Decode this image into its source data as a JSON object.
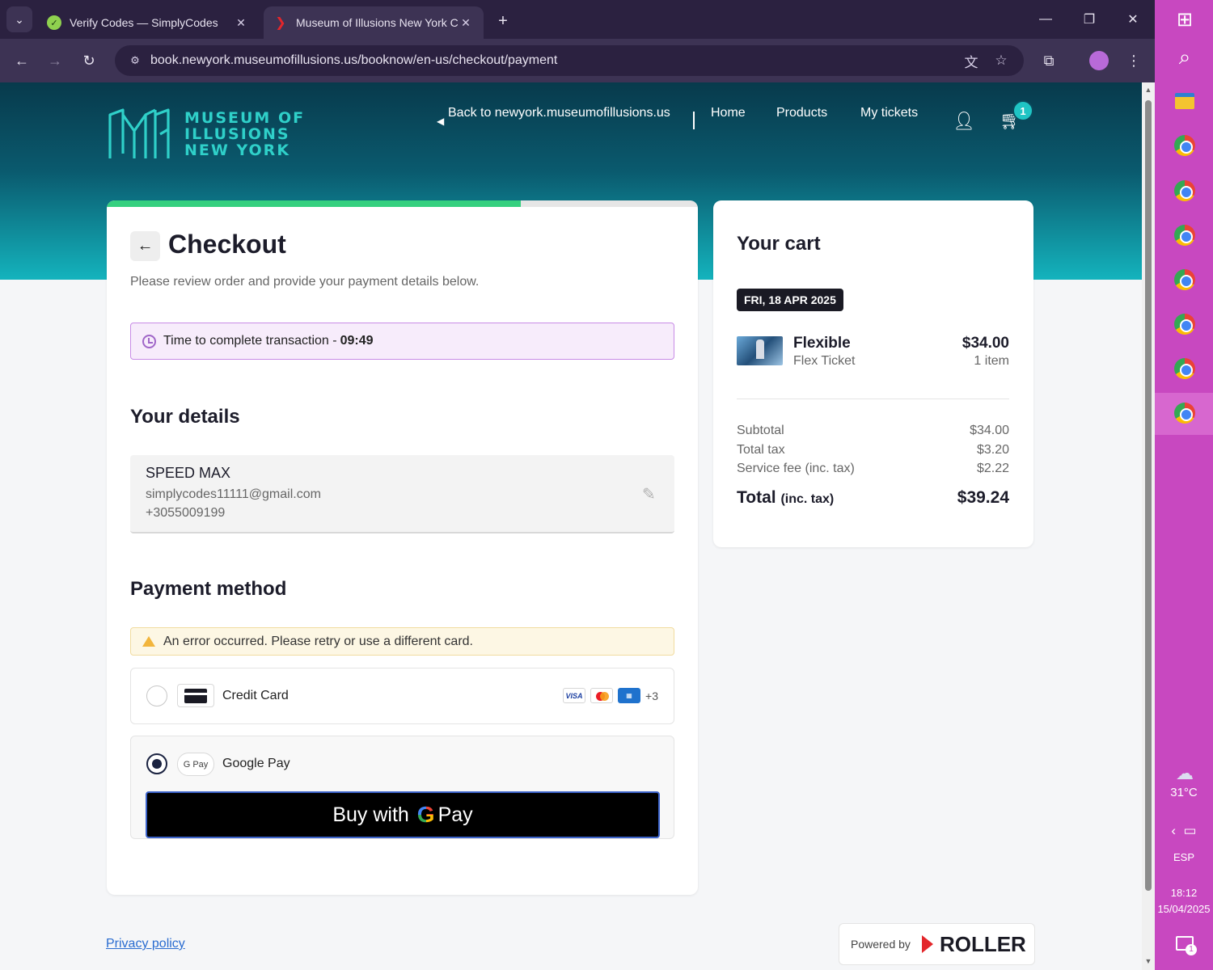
{
  "browser": {
    "tabs": [
      {
        "title": "Verify Codes — SimplyCodes",
        "active": false
      },
      {
        "title": "Museum of Illusions New York Checkout",
        "active": true
      }
    ],
    "url": "book.newyork.museumofillusions.us/booknow/en-us/checkout/payment"
  },
  "header": {
    "logo_lines": [
      "MUSEUM OF",
      "ILLUSIONS",
      "NEW YORK"
    ],
    "nav": {
      "back_link": "Back to newyork.museumofillusions.us",
      "home": "Home",
      "products": "Products",
      "my_tickets": "My tickets"
    },
    "cart_count": "1"
  },
  "checkout": {
    "progress_fraction": 0.7,
    "title": "Checkout",
    "subtitle": "Please review order and provide your payment details below.",
    "timer_label": "Time to complete transaction - ",
    "timer_value": "09:49",
    "details_heading": "Your details",
    "details": {
      "name": "SPEED MAX",
      "email": "simplycodes11111@gmail.com",
      "phone": "+3055009199"
    },
    "payment_heading": "Payment method",
    "error": "An error occurred. Please retry or use a different card.",
    "methods": {
      "credit_card": "Credit Card",
      "google_pay": "Google Pay",
      "gpay_icon": "G Pay",
      "brands": {
        "visa": "VISA",
        "more": "+3"
      }
    },
    "gpay_button": {
      "prefix": "Buy with",
      "g": "G",
      "suffix": "Pay"
    }
  },
  "cart": {
    "title": "Your cart",
    "date": "FRI, 18 APR 2025",
    "item": {
      "name": "Flexible",
      "type": "Flex Ticket",
      "price": "$34.00",
      "qty": "1 item"
    },
    "subtotal_label": "Subtotal",
    "subtotal": "$34.00",
    "tax_label": "Total tax",
    "tax": "$3.20",
    "fee_label": "Service fee (inc. tax)",
    "fee": "$2.22",
    "total_label": "Total",
    "total_note": "(inc. tax)",
    "total": "$39.24"
  },
  "footer": {
    "privacy": "Privacy policy",
    "powered_by": "Powered by",
    "roller": "ROLLER"
  },
  "taskbar": {
    "weather": "31°C",
    "lang": "ESP",
    "time": "18:12",
    "date": "15/04/2025",
    "notifications": "1"
  },
  "colors": {
    "accent": "#1fc4c4",
    "progress": "#35d07f",
    "timer_border": "#c88ce6",
    "taskbar": "#c848c0"
  }
}
